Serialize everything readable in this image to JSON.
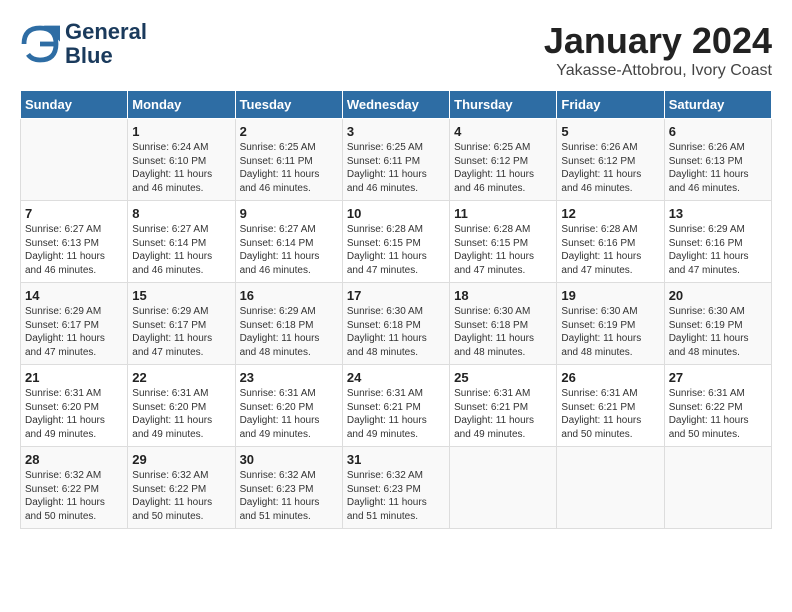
{
  "logo": {
    "line1": "General",
    "line2": "Blue"
  },
  "title": "January 2024",
  "subtitle": "Yakasse-Attobrou, Ivory Coast",
  "days": [
    "Sunday",
    "Monday",
    "Tuesday",
    "Wednesday",
    "Thursday",
    "Friday",
    "Saturday"
  ],
  "weeks": [
    [
      {
        "day": "",
        "text": ""
      },
      {
        "day": "1",
        "text": "Sunrise: 6:24 AM\nSunset: 6:10 PM\nDaylight: 11 hours\nand 46 minutes."
      },
      {
        "day": "2",
        "text": "Sunrise: 6:25 AM\nSunset: 6:11 PM\nDaylight: 11 hours\nand 46 minutes."
      },
      {
        "day": "3",
        "text": "Sunrise: 6:25 AM\nSunset: 6:11 PM\nDaylight: 11 hours\nand 46 minutes."
      },
      {
        "day": "4",
        "text": "Sunrise: 6:25 AM\nSunset: 6:12 PM\nDaylight: 11 hours\nand 46 minutes."
      },
      {
        "day": "5",
        "text": "Sunrise: 6:26 AM\nSunset: 6:12 PM\nDaylight: 11 hours\nand 46 minutes."
      },
      {
        "day": "6",
        "text": "Sunrise: 6:26 AM\nSunset: 6:13 PM\nDaylight: 11 hours\nand 46 minutes."
      }
    ],
    [
      {
        "day": "7",
        "text": "Sunrise: 6:27 AM\nSunset: 6:13 PM\nDaylight: 11 hours\nand 46 minutes."
      },
      {
        "day": "8",
        "text": "Sunrise: 6:27 AM\nSunset: 6:14 PM\nDaylight: 11 hours\nand 46 minutes."
      },
      {
        "day": "9",
        "text": "Sunrise: 6:27 AM\nSunset: 6:14 PM\nDaylight: 11 hours\nand 46 minutes."
      },
      {
        "day": "10",
        "text": "Sunrise: 6:28 AM\nSunset: 6:15 PM\nDaylight: 11 hours\nand 47 minutes."
      },
      {
        "day": "11",
        "text": "Sunrise: 6:28 AM\nSunset: 6:15 PM\nDaylight: 11 hours\nand 47 minutes."
      },
      {
        "day": "12",
        "text": "Sunrise: 6:28 AM\nSunset: 6:16 PM\nDaylight: 11 hours\nand 47 minutes."
      },
      {
        "day": "13",
        "text": "Sunrise: 6:29 AM\nSunset: 6:16 PM\nDaylight: 11 hours\nand 47 minutes."
      }
    ],
    [
      {
        "day": "14",
        "text": "Sunrise: 6:29 AM\nSunset: 6:17 PM\nDaylight: 11 hours\nand 47 minutes."
      },
      {
        "day": "15",
        "text": "Sunrise: 6:29 AM\nSunset: 6:17 PM\nDaylight: 11 hours\nand 47 minutes."
      },
      {
        "day": "16",
        "text": "Sunrise: 6:29 AM\nSunset: 6:18 PM\nDaylight: 11 hours\nand 48 minutes."
      },
      {
        "day": "17",
        "text": "Sunrise: 6:30 AM\nSunset: 6:18 PM\nDaylight: 11 hours\nand 48 minutes."
      },
      {
        "day": "18",
        "text": "Sunrise: 6:30 AM\nSunset: 6:18 PM\nDaylight: 11 hours\nand 48 minutes."
      },
      {
        "day": "19",
        "text": "Sunrise: 6:30 AM\nSunset: 6:19 PM\nDaylight: 11 hours\nand 48 minutes."
      },
      {
        "day": "20",
        "text": "Sunrise: 6:30 AM\nSunset: 6:19 PM\nDaylight: 11 hours\nand 48 minutes."
      }
    ],
    [
      {
        "day": "21",
        "text": "Sunrise: 6:31 AM\nSunset: 6:20 PM\nDaylight: 11 hours\nand 49 minutes."
      },
      {
        "day": "22",
        "text": "Sunrise: 6:31 AM\nSunset: 6:20 PM\nDaylight: 11 hours\nand 49 minutes."
      },
      {
        "day": "23",
        "text": "Sunrise: 6:31 AM\nSunset: 6:20 PM\nDaylight: 11 hours\nand 49 minutes."
      },
      {
        "day": "24",
        "text": "Sunrise: 6:31 AM\nSunset: 6:21 PM\nDaylight: 11 hours\nand 49 minutes."
      },
      {
        "day": "25",
        "text": "Sunrise: 6:31 AM\nSunset: 6:21 PM\nDaylight: 11 hours\nand 49 minutes."
      },
      {
        "day": "26",
        "text": "Sunrise: 6:31 AM\nSunset: 6:21 PM\nDaylight: 11 hours\nand 50 minutes."
      },
      {
        "day": "27",
        "text": "Sunrise: 6:31 AM\nSunset: 6:22 PM\nDaylight: 11 hours\nand 50 minutes."
      }
    ],
    [
      {
        "day": "28",
        "text": "Sunrise: 6:32 AM\nSunset: 6:22 PM\nDaylight: 11 hours\nand 50 minutes."
      },
      {
        "day": "29",
        "text": "Sunrise: 6:32 AM\nSunset: 6:22 PM\nDaylight: 11 hours\nand 50 minutes."
      },
      {
        "day": "30",
        "text": "Sunrise: 6:32 AM\nSunset: 6:23 PM\nDaylight: 11 hours\nand 51 minutes."
      },
      {
        "day": "31",
        "text": "Sunrise: 6:32 AM\nSunset: 6:23 PM\nDaylight: 11 hours\nand 51 minutes."
      },
      {
        "day": "",
        "text": ""
      },
      {
        "day": "",
        "text": ""
      },
      {
        "day": "",
        "text": ""
      }
    ]
  ]
}
